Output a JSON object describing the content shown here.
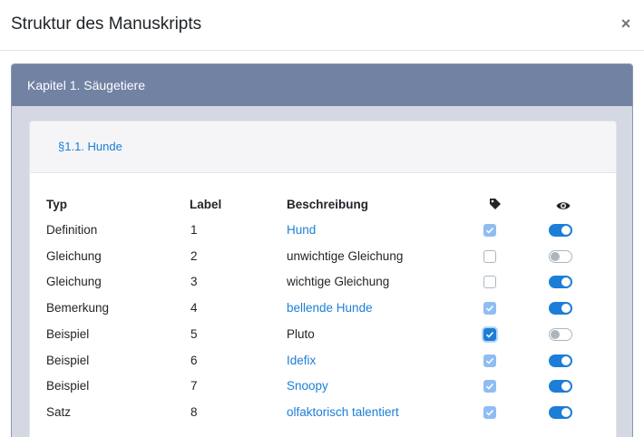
{
  "modal": {
    "title": "Struktur des Manuskripts",
    "close_label": "×"
  },
  "chapter": {
    "title": "Kapitel 1. Säugetiere"
  },
  "section": {
    "title": "§1.1. Hunde"
  },
  "table": {
    "headers": {
      "type": "Typ",
      "label": "Label",
      "description": "Beschreibung",
      "tag_icon": "tag-icon",
      "visibility_icon": "eye-icon"
    },
    "rows": [
      {
        "type": "Definition",
        "label": "1",
        "description": "Hund",
        "is_link": true,
        "tagged": true,
        "visible": true
      },
      {
        "type": "Gleichung",
        "label": "2",
        "description": "unwichtige Gleichung",
        "is_link": false,
        "tagged": false,
        "visible": false
      },
      {
        "type": "Gleichung",
        "label": "3",
        "description": "wichtige Gleichung",
        "is_link": false,
        "tagged": false,
        "visible": true
      },
      {
        "type": "Bemerkung",
        "label": "4",
        "description": "bellende Hunde",
        "is_link": true,
        "tagged": true,
        "visible": true
      },
      {
        "type": "Beispiel",
        "label": "5",
        "description": "Pluto",
        "is_link": false,
        "tagged": true,
        "focused": true,
        "visible": false
      },
      {
        "type": "Beispiel",
        "label": "6",
        "description": "Idefix",
        "is_link": true,
        "tagged": true,
        "visible": true
      },
      {
        "type": "Beispiel",
        "label": "7",
        "description": "Snoopy",
        "is_link": true,
        "tagged": true,
        "visible": true
      },
      {
        "type": "Satz",
        "label": "8",
        "description": "olfaktorisch talentiert",
        "is_link": true,
        "tagged": true,
        "visible": true
      }
    ]
  },
  "colors": {
    "link": "#1c7ed6",
    "chapter_header_bg": "#7282a3",
    "toggle_on": "#1c7ed6"
  }
}
